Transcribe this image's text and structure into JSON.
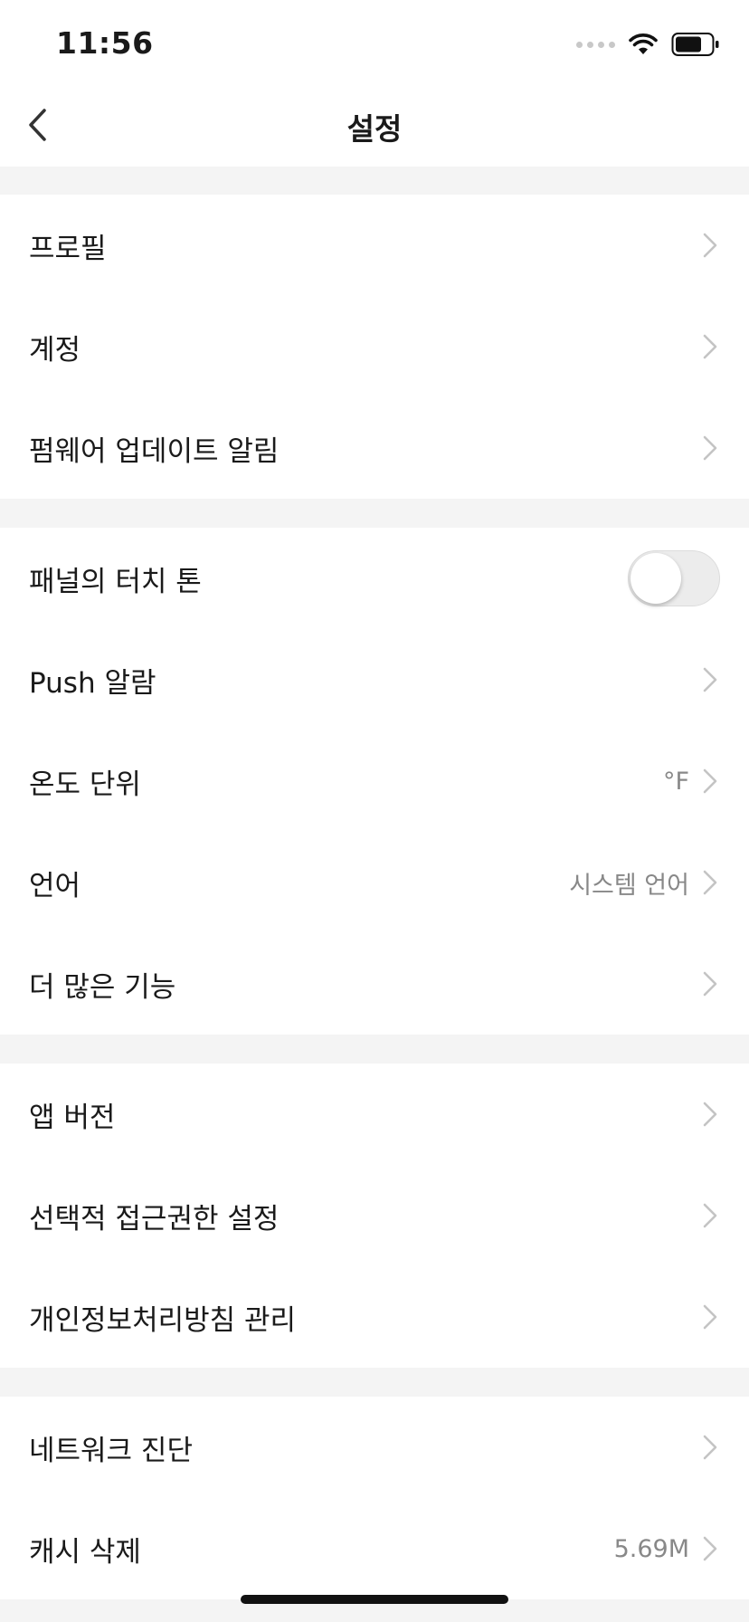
{
  "status_bar": {
    "time": "11:56"
  },
  "nav": {
    "title": "설정"
  },
  "groups": [
    {
      "items": [
        {
          "label": "프로필"
        },
        {
          "label": "계정"
        },
        {
          "label": "펌웨어 업데이트 알림"
        }
      ]
    },
    {
      "items": [
        {
          "label": "패널의 터치 톤",
          "toggle": false
        },
        {
          "label": "Push 알람"
        },
        {
          "label": "온도 단위",
          "value": "°F"
        },
        {
          "label": "언어",
          "value": "시스템 언어"
        },
        {
          "label": "더 많은 기능"
        }
      ]
    },
    {
      "items": [
        {
          "label": "앱 버전"
        },
        {
          "label": "선택적 접근권한 설정"
        },
        {
          "label": "개인정보처리방침 관리"
        }
      ]
    },
    {
      "items": [
        {
          "label": "네트워크 진단"
        },
        {
          "label": "캐시 삭제",
          "value": "5.69M"
        }
      ]
    }
  ],
  "icons": {
    "back": "chevron-left-icon",
    "row_arrow": "chevron-right-icon",
    "wifi": "wifi-icon",
    "battery": "battery-icon"
  },
  "colors": {
    "background": "#f4f4f4",
    "surface": "#ffffff",
    "text": "#1a1a1a",
    "secondary_text": "#888888",
    "chevron": "#c4c4c4",
    "toggle_off": "#ececec"
  }
}
